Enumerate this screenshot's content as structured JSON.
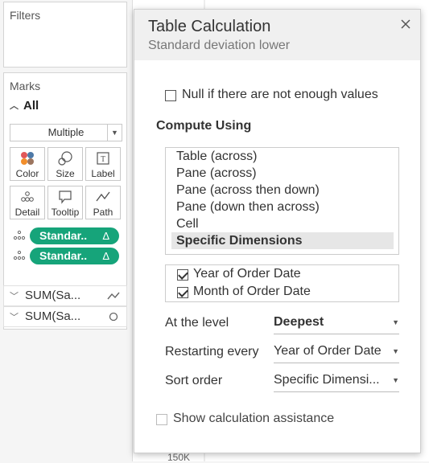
{
  "filters": {
    "title": "Filters"
  },
  "marks": {
    "title": "Marks",
    "all_label": "All",
    "mark_type": "Multiple",
    "tiles": [
      {
        "label": "Color",
        "icon": "color-icon"
      },
      {
        "label": "Size",
        "icon": "size-icon"
      },
      {
        "label": "Label",
        "icon": "label-icon"
      },
      {
        "label": "Detail",
        "icon": "detail-icon"
      },
      {
        "label": "Tooltip",
        "icon": "tooltip-icon"
      },
      {
        "label": "Path",
        "icon": "path-icon"
      }
    ],
    "pills": [
      {
        "label": "Standar..",
        "delta": "Δ"
      },
      {
        "label": "Standar..",
        "delta": "Δ"
      }
    ],
    "measures": [
      {
        "label": "SUM(Sa...",
        "icon": "line-mark-icon"
      },
      {
        "label": "SUM(Sa...",
        "icon": "circle-mark-icon"
      }
    ]
  },
  "view": {
    "axis_label": "150K"
  },
  "dialog": {
    "title": "Table Calculation",
    "subtitle": "Standard deviation lower",
    "null_option": "Null if there are not enough values",
    "compute_using_label": "Compute Using",
    "compute_options": [
      "Table (across)",
      "Pane (across)",
      "Pane (across then down)",
      "Pane (down then across)",
      "Cell",
      "Specific Dimensions"
    ],
    "selected_option": "Specific Dimensions",
    "dimensions": [
      {
        "label": "Year of Order Date",
        "checked": true
      },
      {
        "label": "Month of Order Date",
        "checked": true
      }
    ],
    "level_label": "At the level",
    "level_value": "Deepest",
    "restart_label": "Restarting every",
    "restart_value": "Year of Order Date",
    "sort_label": "Sort order",
    "sort_value": "Specific Dimensi...",
    "assist_label": "Show calculation assistance"
  },
  "colors": {
    "pill": "#16a47a",
    "header_bg": "#f0f0f0"
  }
}
